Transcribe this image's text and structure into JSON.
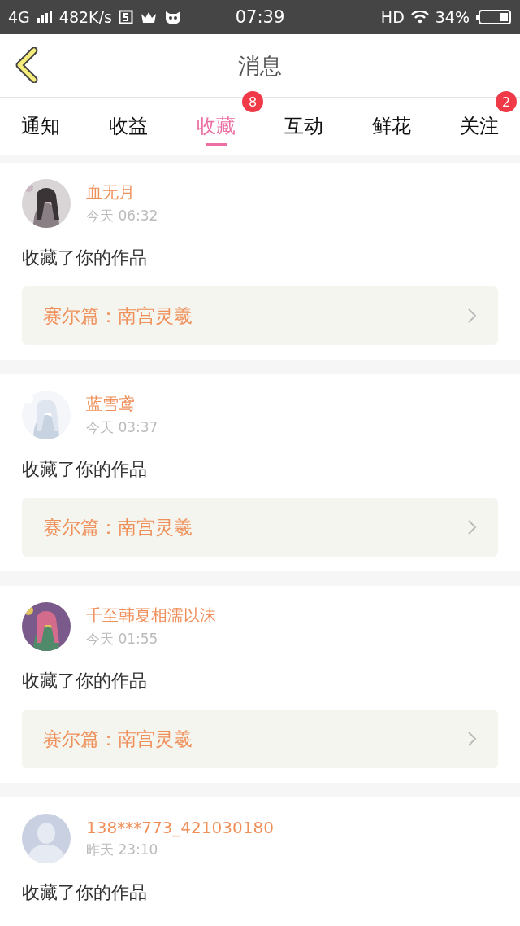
{
  "status_bar": {
    "network": "4G",
    "speed": "482K/s",
    "time": "07:39",
    "hd": "HD",
    "battery": "34%"
  },
  "header": {
    "title": "消息"
  },
  "tabs": [
    {
      "label": "通知",
      "selected": false
    },
    {
      "label": "收益",
      "selected": false
    },
    {
      "label": "收藏",
      "selected": true,
      "badge": "8"
    },
    {
      "label": "互动",
      "selected": false
    },
    {
      "label": "鲜花",
      "selected": false
    },
    {
      "label": "关注",
      "selected": false,
      "badge": "2"
    }
  ],
  "items": [
    {
      "name": "血无月",
      "time": "今天 06:32",
      "action": "收藏了你的作品",
      "work": "赛尔篇：南宫灵羲"
    },
    {
      "name": "蓝雪鸢",
      "time": "今天 03:37",
      "action": "收藏了你的作品",
      "work": "赛尔篇：南宫灵羲"
    },
    {
      "name": "千至韩夏相濡以沫",
      "time": "今天 01:55",
      "action": "收藏了你的作品",
      "work": "赛尔篇：南宫灵羲"
    },
    {
      "avatar": {
        "kind": "default"
      },
      "name": "138***773_421030180",
      "time": "昨天 23:10",
      "action": "收藏了你的作品"
    }
  ]
}
